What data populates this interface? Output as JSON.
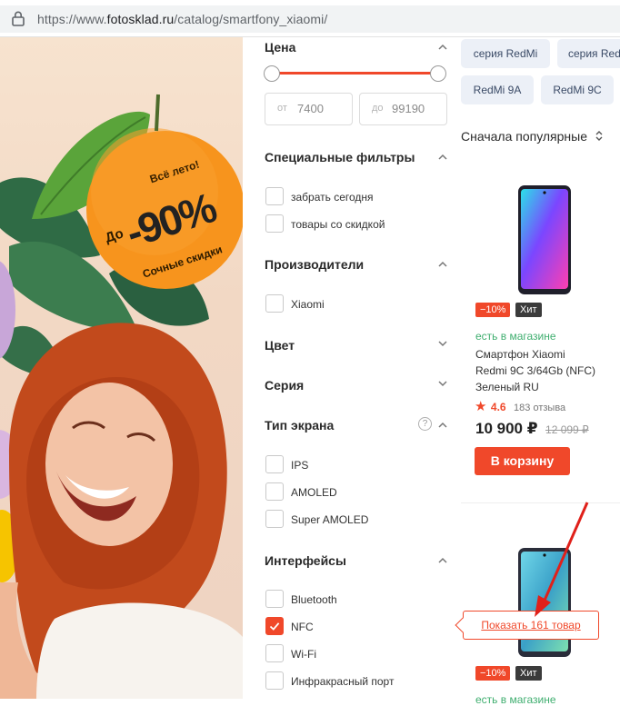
{
  "browser": {
    "url_prefix": "https://www.",
    "url_domain": "fotosklad.ru",
    "url_path": "/catalog/smartfony_xiaomi/"
  },
  "banner": {
    "line1": "Всё лето!",
    "prefix": "До",
    "discount": "-90%",
    "line3": "Сочные скидки"
  },
  "filters": {
    "price": {
      "title": "Цена",
      "from_prefix": "от",
      "from_value": "7400",
      "to_prefix": "до",
      "to_value": "99190"
    },
    "special": {
      "title": "Специальные фильтры",
      "options": [
        "забрать сегодня",
        "товары со скидкой"
      ]
    },
    "brands": {
      "title": "Производители",
      "options": [
        "Xiaomi"
      ]
    },
    "color": {
      "title": "Цвет"
    },
    "series": {
      "title": "Серия"
    },
    "screen": {
      "title": "Тип экрана",
      "help": "?",
      "options": [
        "IPS",
        "AMOLED",
        "Super AMOLED"
      ]
    },
    "interfaces": {
      "title": "Интерфейсы",
      "options": [
        "Bluetooth",
        "NFC",
        "Wi-Fi",
        "Инфракрасный порт"
      ],
      "checked_index": 1
    }
  },
  "chips": [
    "серия RedMi",
    "серия Redmi",
    "RedMi 9A",
    "RedMi 9C"
  ],
  "sort_label": "Сначала популярные",
  "products": [
    {
      "sale_badge": "−10%",
      "hit_badge": "Хит",
      "availability": "есть в магазине",
      "title_line1": "Смартфон Xiaomi",
      "title_line2": "Redmi 9C 3/64Gb (NFC)",
      "title_line3": "Зеленый RU",
      "rating": "4.6",
      "reviews": "183 отзыва",
      "price": "10 900 ₽",
      "old_price": "12 099 ₽",
      "cart_label": "В корзину"
    },
    {
      "sale_badge": "−10%",
      "hit_badge": "Хит",
      "availability": "есть в магазине"
    }
  ],
  "show_results": "Показать 161 товар",
  "colors": {
    "accent": "#f0482a",
    "available": "#3fae6f"
  }
}
